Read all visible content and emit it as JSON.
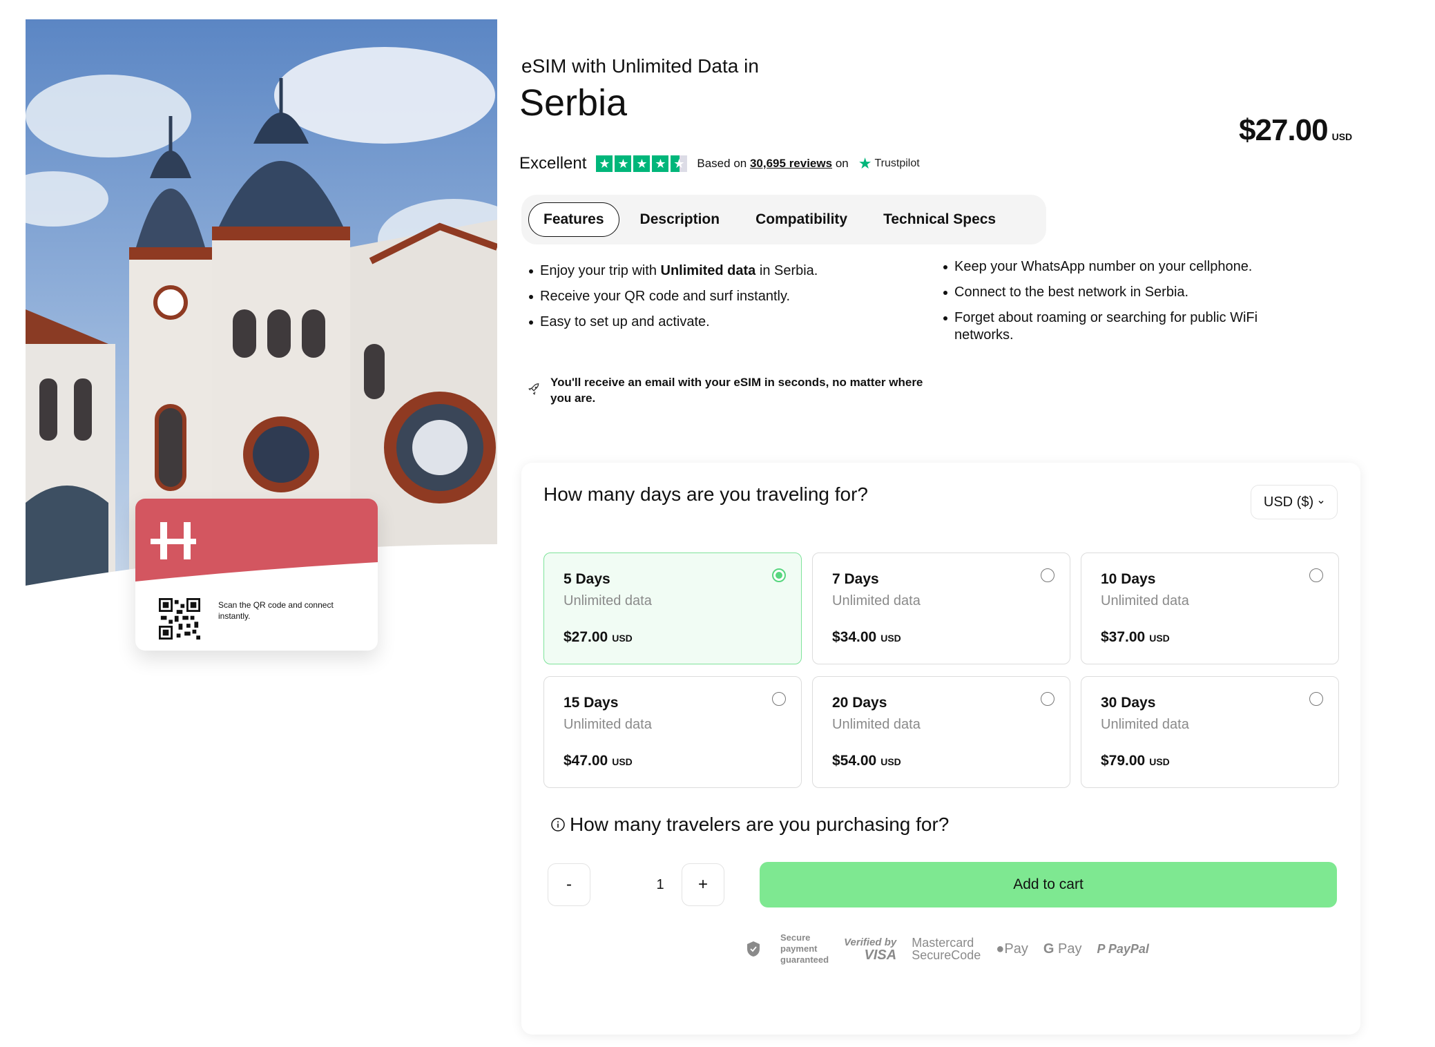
{
  "header": {
    "subtitle": "eSIM with Unlimited Data in",
    "title": "Serbia",
    "price": "$27.00",
    "price_currency": "USD"
  },
  "rating": {
    "label": "Excellent",
    "stars": 4.5,
    "based_prefix": "Based on",
    "reviews": "30,695 reviews",
    "based_suffix": "on",
    "provider": "Trustpilot",
    "star_color": "#00b67a"
  },
  "tabs": [
    "Features",
    "Description",
    "Compatibility",
    "Technical Specs"
  ],
  "active_tab": "Features",
  "features": {
    "left": [
      {
        "pre": "Enjoy your trip with ",
        "bold": "Unlimited data",
        "post": " in Serbia."
      },
      {
        "pre": "Receive your QR code and surf instantly.",
        "bold": "",
        "post": ""
      },
      {
        "pre": "Easy to set up and activate.",
        "bold": "",
        "post": ""
      }
    ],
    "right": [
      "Keep your WhatsApp number on your cellphone.",
      "Connect to the best network in Serbia.",
      "Forget about roaming or searching for public WiFi networks."
    ]
  },
  "notice": {
    "icon": "rocket-icon",
    "text": "You'll receive an email with your eSIM in seconds, no matter where you are."
  },
  "card": {
    "text": "Scan the QR code and connect instantly.",
    "brand_color": "#d35660"
  },
  "plans": {
    "question": "How many days are you traveling for?",
    "currency_select": "USD ($)",
    "options": [
      {
        "days": "5 Days",
        "data": "Unlimited data",
        "price": "$27.00",
        "currency": "USD",
        "selected": true
      },
      {
        "days": "7 Days",
        "data": "Unlimited data",
        "price": "$34.00",
        "currency": "USD",
        "selected": false
      },
      {
        "days": "10 Days",
        "data": "Unlimited data",
        "price": "$37.00",
        "currency": "USD",
        "selected": false
      },
      {
        "days": "15 Days",
        "data": "Unlimited data",
        "price": "$47.00",
        "currency": "USD",
        "selected": false
      },
      {
        "days": "20 Days",
        "data": "Unlimited data",
        "price": "$54.00",
        "currency": "USD",
        "selected": false
      },
      {
        "days": "30 Days",
        "data": "Unlimited data",
        "price": "$79.00",
        "currency": "USD",
        "selected": false
      }
    ]
  },
  "travelers": {
    "question": "How many travelers are you purchasing for?",
    "minus": "-",
    "quantity": "1",
    "plus": "+",
    "add_to_cart": "Add to cart",
    "button_color": "#7ee891"
  },
  "payment": {
    "secure_line1": "Secure",
    "secure_line2": "payment",
    "secure_line3": "guaranteed",
    "verified_line1": "Verified by",
    "verified_line2": "VISA",
    "mastercard_line1": "Mastercard",
    "mastercard_line2": "SecureCode",
    "apple_pay": "Pay",
    "google_pay": "Pay",
    "paypal": "PayPal"
  }
}
